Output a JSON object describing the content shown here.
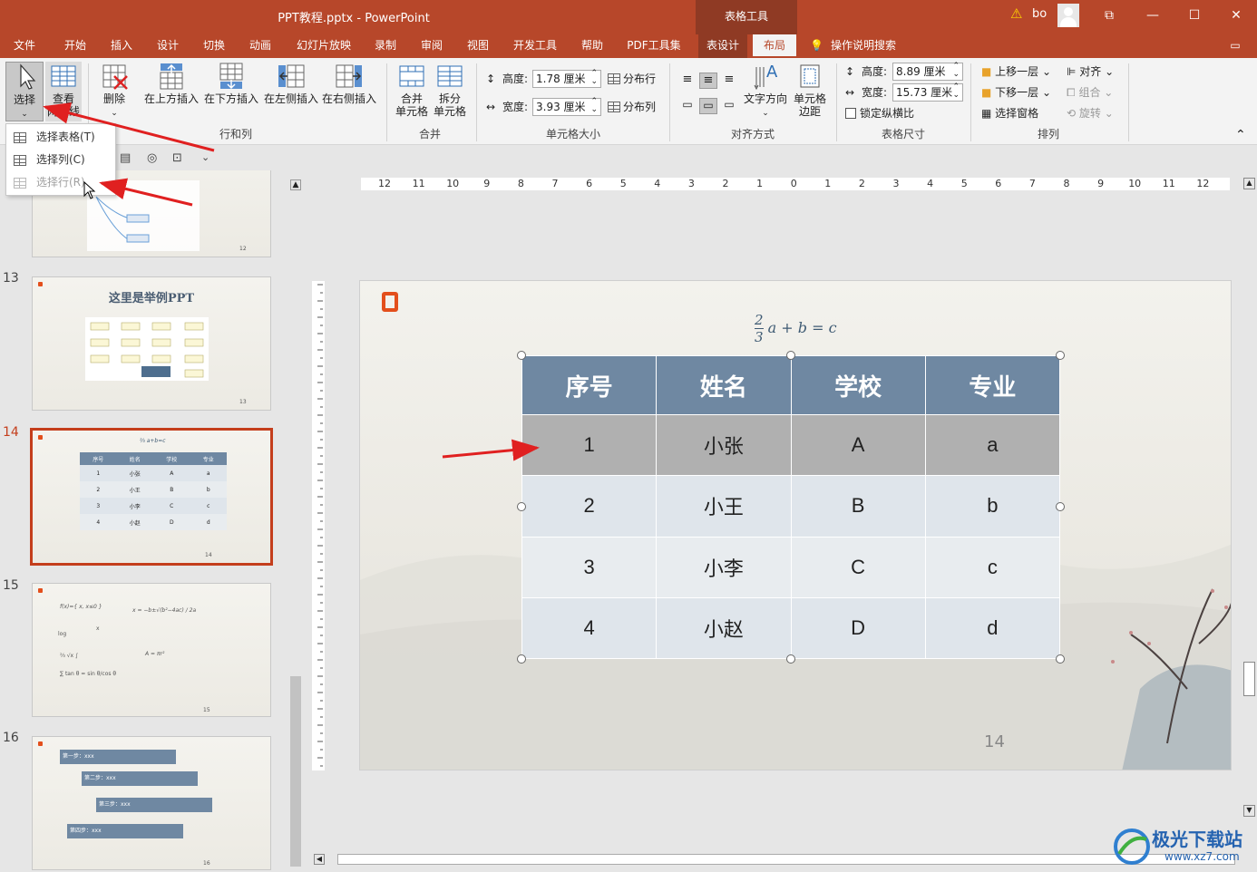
{
  "window": {
    "title": "PPT教程.pptx  -  PowerPoint",
    "context_tab": "表格工具",
    "user": "bo"
  },
  "menu": [
    "文件",
    "开始",
    "插入",
    "设计",
    "切换",
    "动画",
    "幻灯片放映",
    "录制",
    "审阅",
    "视图",
    "开发工具",
    "帮助",
    "PDF工具集",
    "表设计",
    "布局",
    "操作说明搜索"
  ],
  "active_menu": "布局",
  "ribbon": {
    "select": "选择",
    "view_gridlines": "查看\n网格线",
    "delete": "删除",
    "insert_above": "在上方插入",
    "insert_below": "在下方插入",
    "insert_left": "在左侧插入",
    "insert_right": "在右侧插入",
    "merge_cells": "合并\n单元格",
    "split_cells": "拆分\n单元格",
    "height_label": "高度:",
    "height_value": "1.78 厘米",
    "width_label": "宽度:",
    "width_value": "3.93 厘米",
    "distribute_rows": "分布行",
    "distribute_cols": "分布列",
    "text_direction": "文字方向",
    "cell_margins": "单元格\n边距",
    "table_height_label": "高度:",
    "table_height_value": "8.89 厘米",
    "table_width_label": "宽度:",
    "table_width_value": "15.73 厘米",
    "lock_ratio": "锁定纵横比",
    "bring_forward": "上移一层",
    "send_backward": "下移一层",
    "selection_pane": "选择窗格",
    "align": "对齐",
    "group": "组合",
    "rotate": "旋转",
    "groups": [
      "行和列",
      "合并",
      "单元格大小",
      "对齐方式",
      "表格尺寸",
      "排列"
    ]
  },
  "dropdown": [
    "选择表格(T)",
    "选择列(C)",
    "选择行(R)"
  ],
  "thumbnails": {
    "slide13_title": "这里是举例PPT",
    "slide14_headers": [
      "序号",
      "姓名",
      "学校",
      "专业"
    ],
    "slide16_steps": [
      "第一步：xxx",
      "第二步：xxx",
      "第三步：xxx",
      "第四步：xxx"
    ],
    "numbers": [
      "13",
      "14",
      "15",
      "16"
    ]
  },
  "slide": {
    "formula": "a + b = c",
    "formula_num": "2",
    "formula_den": "3",
    "table_headers": [
      "序号",
      "姓名",
      "学校",
      "专业"
    ],
    "table_rows": [
      [
        "1",
        "小张",
        "A",
        "a"
      ],
      [
        "2",
        "小王",
        "B",
        "b"
      ],
      [
        "3",
        "小李",
        "C",
        "c"
      ],
      [
        "4",
        "小赵",
        "D",
        "d"
      ]
    ],
    "page_number": "14"
  },
  "ruler_labels": [
    "12",
    "11",
    "10",
    "9",
    "8",
    "7",
    "6",
    "5",
    "4",
    "3",
    "2",
    "1",
    "0",
    "1",
    "2",
    "3",
    "4",
    "5",
    "6",
    "7",
    "8",
    "9",
    "10",
    "11",
    "12"
  ],
  "watermark": {
    "brand": "极光下载站",
    "url": "www.xz7.com"
  },
  "colors": {
    "accent": "#b7472a",
    "header": "#6f88a2",
    "arrow": "#e02020"
  }
}
